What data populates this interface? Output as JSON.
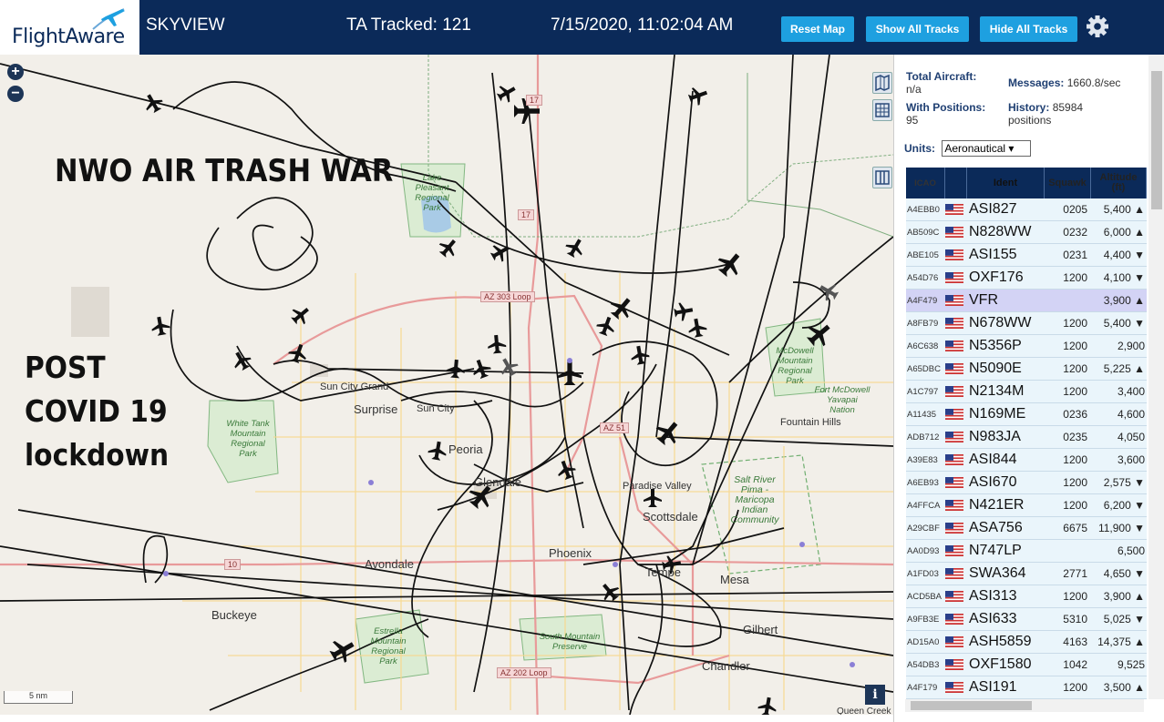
{
  "header": {
    "logo_text": "FlightAware",
    "app_name": "SKYVIEW",
    "ta_tracked": "TA Tracked: 121",
    "datetime": "7/15/2020, 11:02:04 AM",
    "reset_map": "Reset Map",
    "show_all_tracks": "Show All Tracks",
    "hide_all_tracks": "Hide All Tracks",
    "settings_icon": "gear-icon"
  },
  "map": {
    "overlay_title": "NWO AIR TRASH WAR",
    "overlay_lines": [
      "POST",
      "COVID 19",
      "lockdown"
    ],
    "zoom_in": "+",
    "zoom_out": "−",
    "scale": "5 nm",
    "info": "i",
    "labels": {
      "sun_city_grand": "Sun City Grand",
      "surprise": "Surprise",
      "sun_city": "Sun City",
      "peoria": "Peoria",
      "glendale": "Glendale",
      "paradise_valley": "Paradise Valley",
      "scottsdale": "Scottsdale",
      "phoenix": "Phoenix",
      "avondale": "Avondale",
      "tempe": "Tempe",
      "mesa": "Mesa",
      "buckeye": "Buckeye",
      "gilbert": "Gilbert",
      "chandler": "Chandler",
      "fountain_hills": "Fountain Hills",
      "queen_creek": "Queen Creek",
      "white_tank": "White Tank Mountain Regional Park",
      "lake_pleasant": "Lake Pleasant Regional Park",
      "mcdowell": "McDowell Mountain Regional Park",
      "fort_mcdowell": "Fort McDowell Yavapai Nation",
      "salt_river": "Salt River Pima - Maricopa Indian Community",
      "estrella": "Estrella Mountain Regional Park",
      "south_mountain": "South Mountain Preserve",
      "az303": "AZ 303 Loop",
      "az202": "AZ 202 Loop",
      "az51": "AZ 51",
      "i17a": "17",
      "i17b": "17",
      "i10": "10"
    }
  },
  "stats": {
    "total_aircraft_label": "Total Aircraft:",
    "total_aircraft_value": "n/a",
    "messages_label": "Messages:",
    "messages_value": "1660.8/sec",
    "with_positions_label": "With Positions:",
    "with_positions_value": "95",
    "history_label": "History:",
    "history_value": "85984 positions",
    "units_label": "Units:",
    "units_value": "Aeronautical"
  },
  "table": {
    "headers": {
      "icao": "ICAO",
      "ident": "Ident",
      "squawk": "Squawk",
      "alt_line1": "Altitude",
      "alt_line2": "(ft)"
    },
    "rows": [
      {
        "icao": "A4EBB0",
        "ident": "ASI827",
        "squawk": "0205",
        "alt": "5,400 ▲"
      },
      {
        "icao": "AB509C",
        "ident": "N828WW",
        "squawk": "0232",
        "alt": "6,000 ▲"
      },
      {
        "icao": "ABE105",
        "ident": "ASI155",
        "squawk": "0231",
        "alt": "4,400 ▼"
      },
      {
        "icao": "A54D76",
        "ident": "OXF176",
        "squawk": "1200",
        "alt": "4,100 ▼"
      },
      {
        "icao": "A4F479",
        "ident": "VFR",
        "squawk": "",
        "alt": "3,900 ▲",
        "selected": true
      },
      {
        "icao": "A8FB79",
        "ident": "N678WW",
        "squawk": "1200",
        "alt": "5,400 ▼"
      },
      {
        "icao": "A6C638",
        "ident": "N5356P",
        "squawk": "1200",
        "alt": "2,900"
      },
      {
        "icao": "A65DBC",
        "ident": "N5090E",
        "squawk": "1200",
        "alt": "5,225 ▲"
      },
      {
        "icao": "A1C797",
        "ident": "N2134M",
        "squawk": "1200",
        "alt": "3,400"
      },
      {
        "icao": "A11435",
        "ident": "N169ME",
        "squawk": "0236",
        "alt": "4,600"
      },
      {
        "icao": "ADB712",
        "ident": "N983JA",
        "squawk": "0235",
        "alt": "4,050"
      },
      {
        "icao": "A39E83",
        "ident": "ASI844",
        "squawk": "1200",
        "alt": "3,600"
      },
      {
        "icao": "A6EB93",
        "ident": "ASI670",
        "squawk": "1200",
        "alt": "2,575 ▼"
      },
      {
        "icao": "A4FFCA",
        "ident": "N421ER",
        "squawk": "1200",
        "alt": "6,200 ▼"
      },
      {
        "icao": "A29CBF",
        "ident": "ASA756",
        "squawk": "6675",
        "alt": "11,900 ▼"
      },
      {
        "icao": "AA0D93",
        "ident": "N747LP",
        "squawk": "",
        "alt": "6,500"
      },
      {
        "icao": "A1FD03",
        "ident": "SWA364",
        "squawk": "2771",
        "alt": "4,650 ▼"
      },
      {
        "icao": "ACD5BA",
        "ident": "ASI313",
        "squawk": "1200",
        "alt": "3,900 ▲"
      },
      {
        "icao": "A9FB3E",
        "ident": "ASI633",
        "squawk": "5310",
        "alt": "5,025 ▼"
      },
      {
        "icao": "AD15A0",
        "ident": "ASH5859",
        "squawk": "4163",
        "alt": "14,375 ▲"
      },
      {
        "icao": "A54DB3",
        "ident": "OXF1580",
        "squawk": "1042",
        "alt": "9,525"
      },
      {
        "icao": "A4F179",
        "ident": "ASI191",
        "squawk": "1200",
        "alt": "3,500 ▲"
      }
    ]
  },
  "colors": {
    "header_bg": "#0b2a59",
    "button_bg": "#1ea0e0",
    "row_bg": "#eaf5fb",
    "row_selected": "#d3d3f5"
  }
}
